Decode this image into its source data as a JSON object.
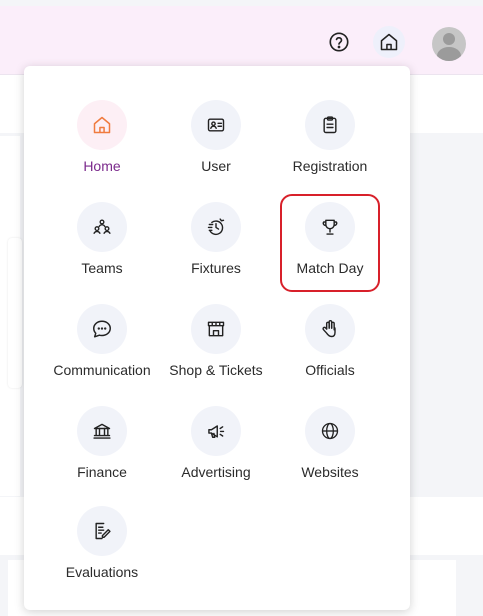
{
  "header": {
    "help_icon": "help-circle-icon",
    "home_icon": "home-icon",
    "avatar": "user-avatar"
  },
  "menu": {
    "items": [
      {
        "label": "Home",
        "icon": "home-icon",
        "active": true
      },
      {
        "label": "User",
        "icon": "id-card-icon"
      },
      {
        "label": "Registration",
        "icon": "clipboard-icon"
      },
      {
        "label": "Teams",
        "icon": "people-group-icon"
      },
      {
        "label": "Fixtures",
        "icon": "fixtures-cycle-icon"
      },
      {
        "label": "Match Day",
        "icon": "trophy-icon",
        "highlighted": true
      },
      {
        "label": "Communication",
        "icon": "chat-bubble-icon"
      },
      {
        "label": "Shop & Tickets",
        "icon": "storefront-icon"
      },
      {
        "label": "Officials",
        "icon": "raised-hand-icon"
      },
      {
        "label": "Finance",
        "icon": "bank-icon"
      },
      {
        "label": "Advertising",
        "icon": "megaphone-icon"
      },
      {
        "label": "Websites",
        "icon": "globe-icon"
      },
      {
        "label": "Evaluations",
        "icon": "edit-document-icon"
      }
    ]
  },
  "colors": {
    "active_label": "#7b2a8c",
    "active_icon": "#f07b3f",
    "highlight_border": "#d8202a",
    "topbar_bg": "#fbeefa"
  }
}
